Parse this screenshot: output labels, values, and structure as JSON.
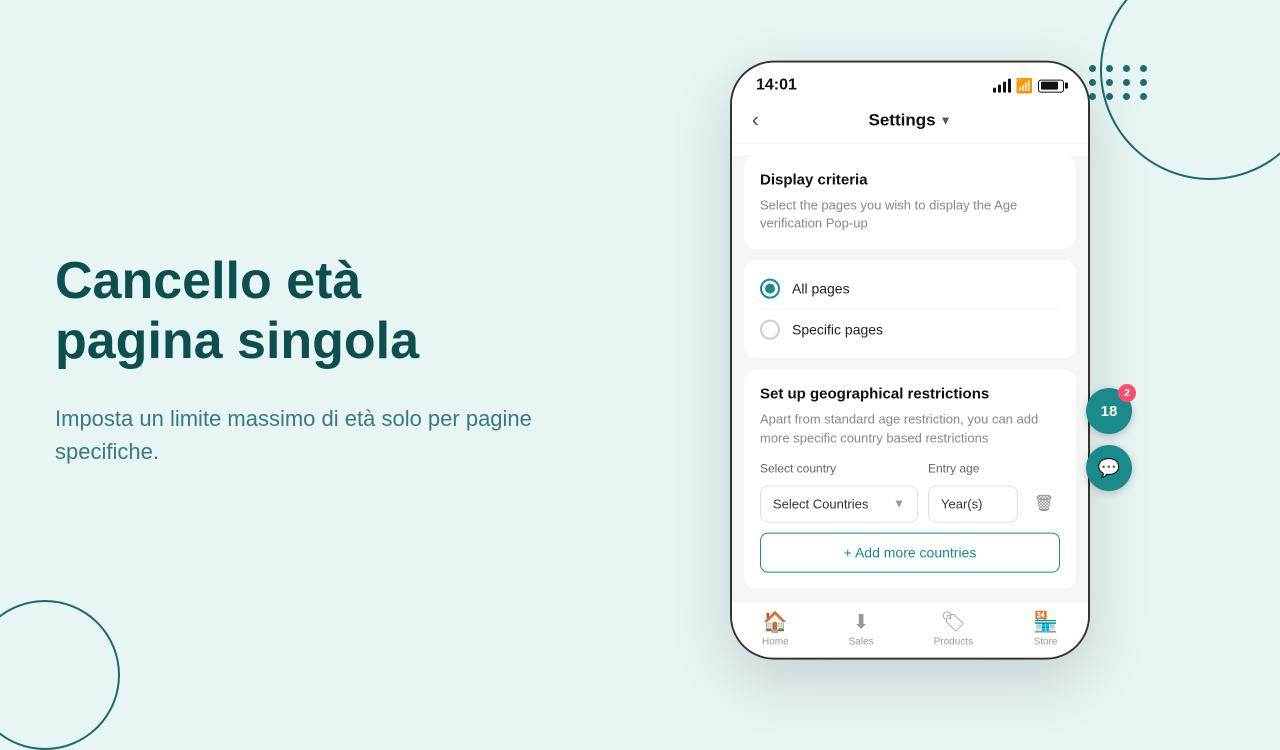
{
  "background_color": "#e8f5f5",
  "left": {
    "title_line1": "Cancello età",
    "title_line2": "pagina singola",
    "subtitle": "Imposta un limite massimo di età solo per pagine specifiche."
  },
  "phone": {
    "status_bar": {
      "time": "14:01"
    },
    "header": {
      "title": "Settings",
      "back_label": "‹"
    },
    "display_criteria": {
      "title": "Display criteria",
      "description": "Select the pages you wish to display the Age verification Pop-up",
      "options": [
        {
          "label": "All pages",
          "selected": true
        },
        {
          "label": "Specific pages",
          "selected": false
        }
      ]
    },
    "geo_section": {
      "title": "Set up geographical restrictions",
      "description": "Apart from standard age restriction, you can add more specific country based restrictions",
      "country_label": "Select country",
      "entry_age_label": "Entry age",
      "select_placeholder": "Select Countries",
      "entry_age_value": "Year(s)",
      "add_button": "+ Add more countries"
    },
    "fab_18": {
      "label": "18",
      "badge": "2"
    },
    "fab_chat": {
      "icon": "💬"
    },
    "bottom_nav": [
      {
        "icon": "🏠",
        "label": "Home"
      },
      {
        "icon": "⬇",
        "label": "Sales"
      },
      {
        "icon": "🏷",
        "label": "Products"
      },
      {
        "icon": "🏪",
        "label": "Store"
      }
    ]
  }
}
